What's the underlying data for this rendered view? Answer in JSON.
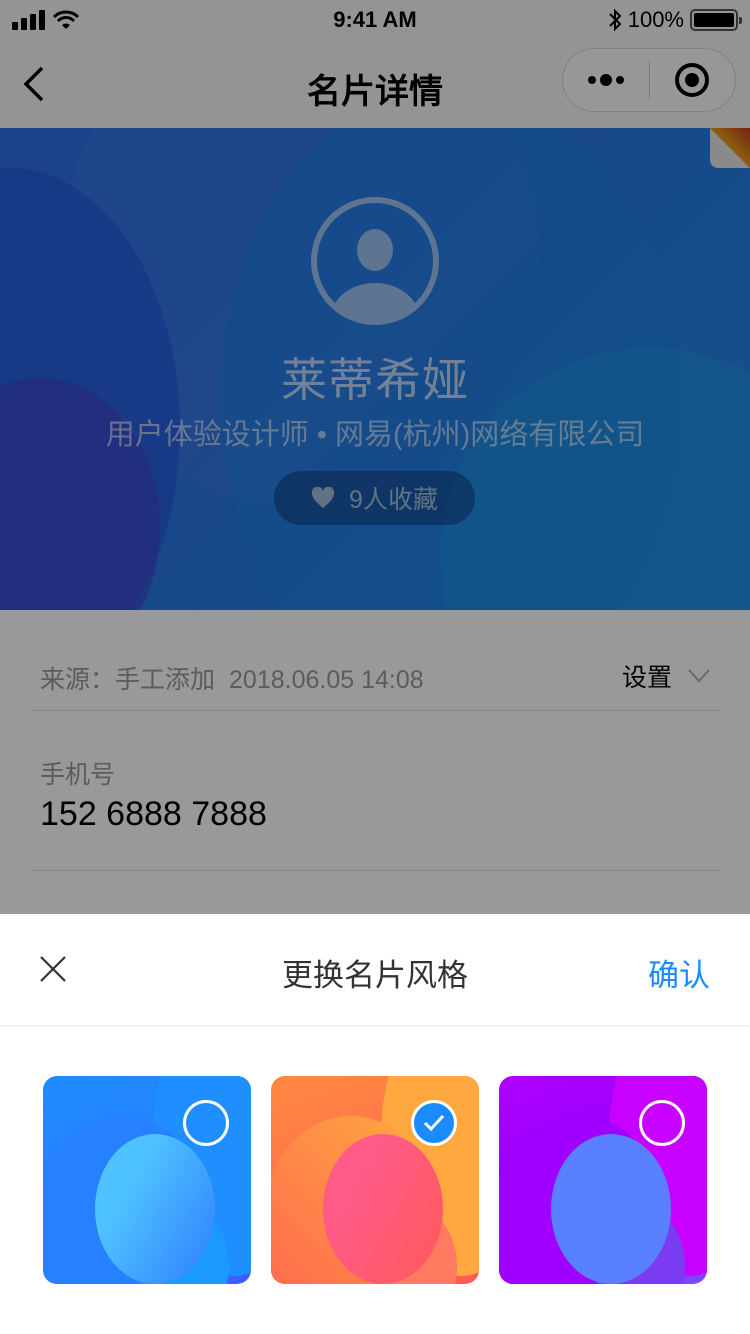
{
  "status_bar": {
    "time": "9:41 AM",
    "battery_percent": "100%",
    "icons": [
      "signal-icon",
      "wifi-icon",
      "bluetooth-icon",
      "battery-icon"
    ]
  },
  "nav": {
    "title": "名片详情",
    "back_icon": "chevron-left-icon",
    "more_icon": "more-dots-icon",
    "close_icon": "target-circle-icon"
  },
  "card": {
    "name": "莱蒂希娅",
    "subtitle": "用户体验设计师 • 网易(杭州)网络有限公司",
    "favorites_label": "9人收藏",
    "favorites_icon": "heart-icon",
    "theme_color": "#2a7be6"
  },
  "info": {
    "source_label": "来源：手工添加",
    "source_date": "2018.06.05 14:08",
    "settings_label": "设置",
    "phone_label": "手机号",
    "phone_value": "152 6888 7888"
  },
  "sheet": {
    "title": "更换名片风格",
    "confirm_label": "确认",
    "accent_color": "#1a8cff",
    "styles": [
      {
        "name": "blue",
        "selected": false
      },
      {
        "name": "orange",
        "selected": true
      },
      {
        "name": "purple",
        "selected": false
      }
    ]
  }
}
